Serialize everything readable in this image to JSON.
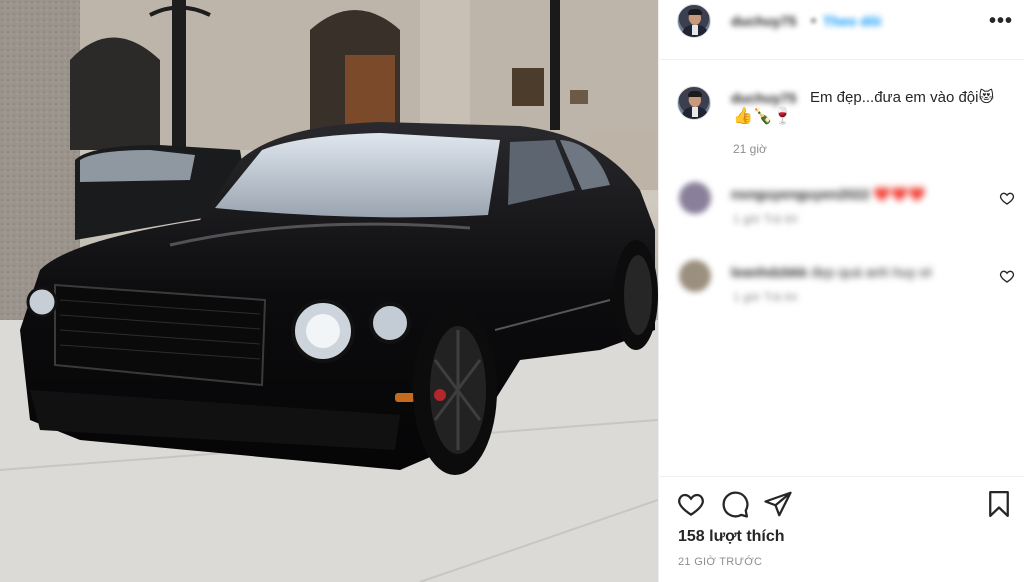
{
  "post": {
    "photo_alt": "Xe Bentley màu đen",
    "header": {
      "username": "duchuy75",
      "separator": "•",
      "follow_label": "Theo dõi",
      "more_label": "•••"
    },
    "caption": {
      "username": "duchuy75",
      "text_line1": "Em đẹp...đưa em vào đội😻",
      "text_line2": "👍🍾🍷",
      "time": "21 giờ"
    },
    "comments": [
      {
        "username": "nsnguyenguyen2022",
        "text": "❤️❤️❤️",
        "meta": "1 giờ    Trả lời"
      },
      {
        "username": "leanhdzbkk",
        "text": "đẹp quá anh huy ơi",
        "meta": "1 giờ    Trả lời"
      }
    ],
    "likes": "158 lượt thích",
    "posted": "21 GIỜ TRƯỚC"
  }
}
